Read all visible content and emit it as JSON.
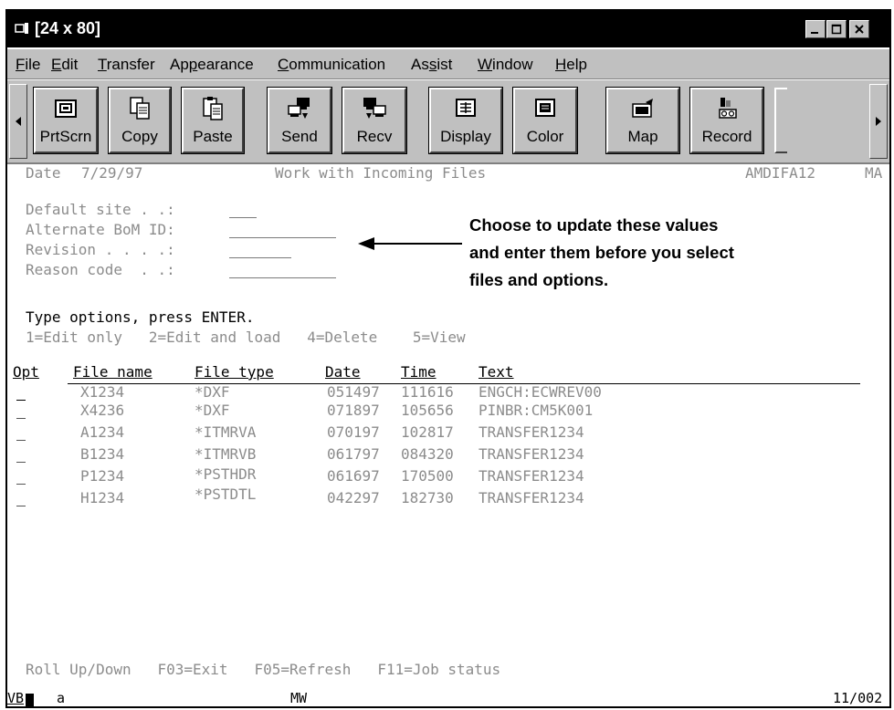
{
  "window": {
    "title": "[24 x 80]"
  },
  "menubar": {
    "items": [
      {
        "label": "File",
        "u": "F",
        "rest": "ile"
      },
      {
        "label": "Edit",
        "u": "E",
        "rest": "dit"
      },
      {
        "label": "Transfer",
        "u": "T",
        "rest": "ransfer"
      },
      {
        "label": "Appearance",
        "pre": "Ap",
        "u": "p",
        "rest": "earance"
      },
      {
        "label": "Communication",
        "u": "C",
        "rest": "ommunication"
      },
      {
        "label": "Assist",
        "pre": "As",
        "u": "s",
        "rest": "ist"
      },
      {
        "label": "Window",
        "u": "W",
        "rest": "indow"
      },
      {
        "label": "Help",
        "u": "H",
        "rest": "elp"
      }
    ]
  },
  "toolbar": {
    "buttons": [
      {
        "label": "PrtScrn",
        "icon": "print-screen-icon"
      },
      {
        "label": "Copy",
        "icon": "copy-icon"
      },
      {
        "label": "Paste",
        "icon": "paste-icon"
      },
      {
        "label": "Send",
        "icon": "send-icon"
      },
      {
        "label": "Recv",
        "icon": "receive-icon"
      },
      {
        "label": "Display",
        "icon": "display-icon"
      },
      {
        "label": "Color",
        "icon": "color-icon"
      },
      {
        "label": "Map",
        "icon": "map-icon"
      },
      {
        "label": "Record",
        "icon": "record-icon"
      }
    ]
  },
  "screen": {
    "date_label": "Date",
    "date_value": "7/29/97",
    "title": "Work with Incoming Files",
    "program": "AMDIFA12",
    "right_cut": "MA",
    "fields": [
      {
        "label": "Default site . .:"
      },
      {
        "label": "Alternate BoM ID:"
      },
      {
        "label": "Revision . . . .:"
      },
      {
        "label": "Reason code  . .:"
      }
    ],
    "instructions": "Type options, press ENTER.",
    "options": "1=Edit only   2=Edit and load   4=Delete    5=View",
    "columns": {
      "opt": "Opt",
      "file_name": "File name",
      "file_type": "File type",
      "date": "Date",
      "time": "Time",
      "text": "Text"
    },
    "rows": [
      {
        "file_name": "X1234",
        "file_type": "*DXF",
        "date": "051497",
        "time": "111616",
        "text": "ENGCH:ECWREV00"
      },
      {
        "file_name": "X4236",
        "file_type": "*DXF",
        "date": "071897",
        "time": "105656",
        "text": "PINBR:CM5K001"
      },
      {
        "file_name": "A1234",
        "file_type": "*ITMRVA",
        "date": "070197",
        "time": "102817",
        "text": "TRANSFER1234"
      },
      {
        "file_name": "B1234",
        "file_type": "*ITMRVB",
        "date": "061797",
        "time": "084320",
        "text": "TRANSFER1234"
      },
      {
        "file_name": "P1234",
        "file_type": "*PSTHDR",
        "date": "061697",
        "time": "170500",
        "text": "TRANSFER1234"
      },
      {
        "file_name": "H1234",
        "file_type": "*PSTDTL",
        "date": "042297",
        "time": "182730",
        "text": "TRANSFER1234"
      }
    ],
    "function_keys": "Roll Up/Down   F03=Exit   F05=Refresh   F11=Job status",
    "status": {
      "left": "VB",
      "mode": "a",
      "session": "MW",
      "position": "11/002"
    }
  },
  "annotation": {
    "line1": "Choose to update these values",
    "line2": "and enter them before you select",
    "line3": "files and options."
  }
}
